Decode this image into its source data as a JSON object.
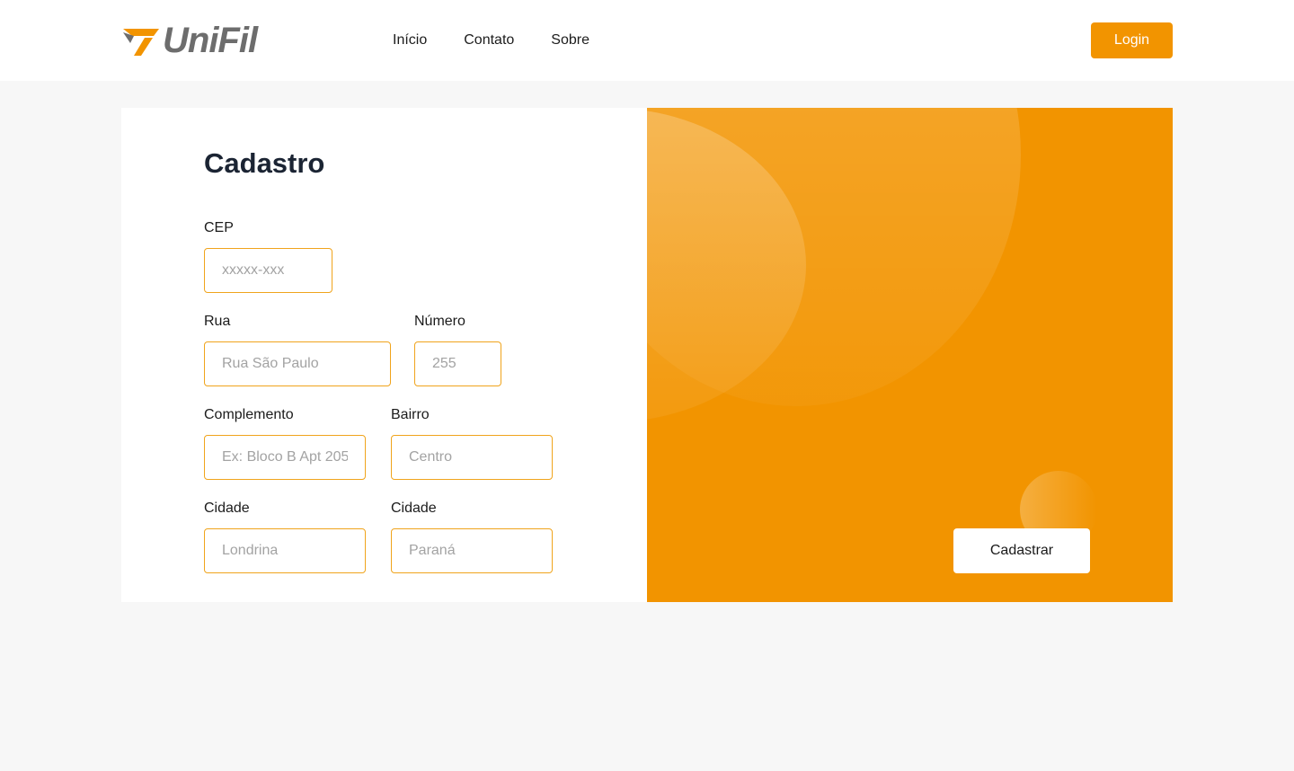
{
  "header": {
    "logo_text": "UniFil",
    "nav": [
      "Início",
      "Contato",
      "Sobre"
    ],
    "login_label": "Login"
  },
  "form": {
    "title": "Cadastro",
    "fields": {
      "cep": {
        "label": "CEP",
        "placeholder": "xxxxx-xxx"
      },
      "rua": {
        "label": "Rua",
        "placeholder": "Rua São Paulo"
      },
      "numero": {
        "label": "Número",
        "placeholder": "255"
      },
      "complemento": {
        "label": "Complemento",
        "placeholder": "Ex: Bloco B Apt 205"
      },
      "bairro": {
        "label": "Bairro",
        "placeholder": "Centro"
      },
      "cidade": {
        "label": "Cidade",
        "placeholder": "Londrina"
      },
      "estado": {
        "label": "Cidade",
        "placeholder": "Paraná"
      }
    },
    "submit_label": "Cadastrar"
  },
  "colors": {
    "accent": "#f29400",
    "input_border": "#f0a41c",
    "title": "#1b2433",
    "background": "#f7f7f7"
  }
}
